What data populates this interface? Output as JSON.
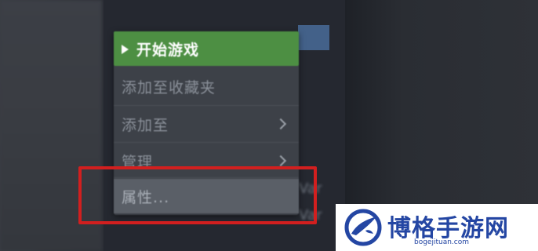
{
  "menu": {
    "items": [
      {
        "label": "开始游戏",
        "icon": "play-icon",
        "primary": true
      },
      {
        "label": "添加至收藏夹"
      },
      {
        "label": "添加至",
        "submenu": true
      },
      {
        "label": "管理",
        "submenu": true
      },
      {
        "label": "属性...",
        "highlighted": true
      }
    ]
  },
  "background": {
    "left_fragments": [
      "",
      ""
    ],
    "right_fragments": [
      "Var",
      "Var"
    ]
  },
  "watermark": {
    "title": "博格手游网",
    "url": "bogejituan.com"
  },
  "colors": {
    "menu_bg": "#3d4148",
    "primary_green": "#4d8f43",
    "highlight_gray": "#5a5f67",
    "annotation_red": "#d21f1f",
    "watermark_blue": "#2446a3"
  }
}
